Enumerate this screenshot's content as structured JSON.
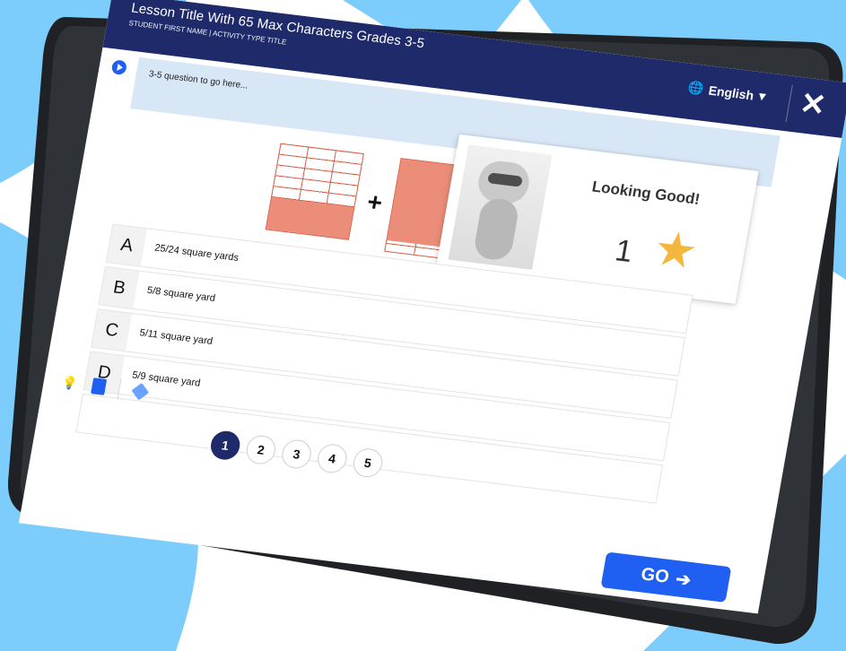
{
  "header": {
    "lesson_title": "Lesson Title With 65 Max Characters Grades 3-5",
    "subtitle": "STUDENT FIRST NAME | ACTIVITY TYPE TITLE",
    "language": "English"
  },
  "question": {
    "text": "3-5 question to go here..."
  },
  "answers": [
    {
      "letter": "A",
      "text": "25/24 square yards"
    },
    {
      "letter": "B",
      "text": "5/8 square yard"
    },
    {
      "letter": "C",
      "text": "5/11 square yard"
    },
    {
      "letter": "D",
      "text": "5/9 square yard"
    }
  ],
  "pagination": {
    "pages": [
      "1",
      "2",
      "3",
      "4",
      "5"
    ],
    "active_page": "1"
  },
  "reward": {
    "message": "Looking Good!",
    "count": "1"
  },
  "buttons": {
    "go_label": "GO"
  },
  "icons": {
    "audio": "play-icon",
    "language": "globe-icon",
    "close": "close-icon",
    "star": "star-icon",
    "arrow": "arrow-right-icon"
  },
  "colors": {
    "header": "#1f2a6b",
    "accent": "#1f5ff1",
    "question_bg": "#d7e7f6",
    "grid_fill": "#ec8d7a",
    "star": "#f4b63c"
  }
}
